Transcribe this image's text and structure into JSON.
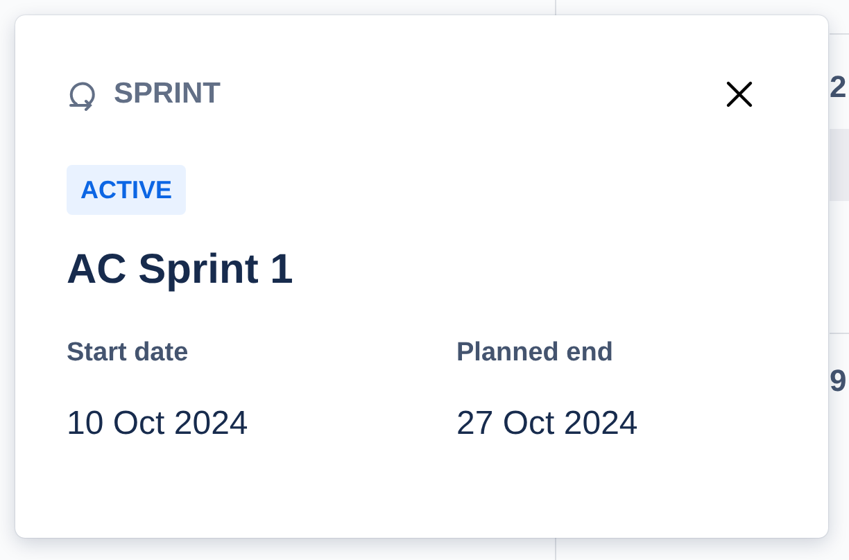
{
  "background": {
    "cells": [
      "2",
      "9"
    ]
  },
  "popup": {
    "type_label": "SPRINT",
    "status": "ACTIVE",
    "title": "AC Sprint 1",
    "fields": [
      {
        "label": "Start date",
        "value": "10 Oct 2024"
      },
      {
        "label": "Planned end",
        "value": "27 Oct 2024"
      }
    ]
  }
}
